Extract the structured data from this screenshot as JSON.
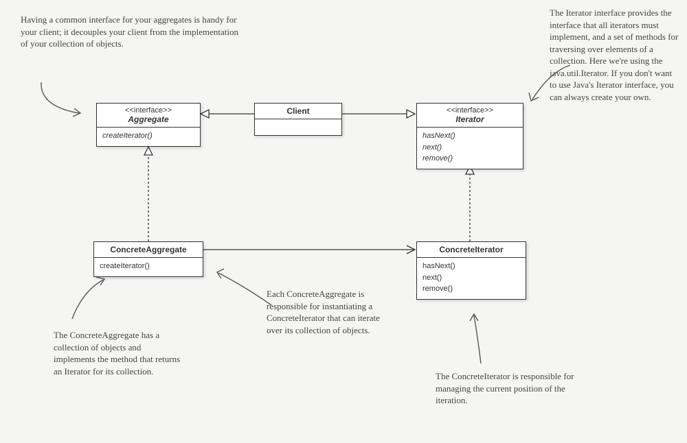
{
  "boxes": {
    "aggregate": {
      "stereo": "<<interface>>",
      "name": "Aggregate",
      "methods": [
        "createIterator()"
      ]
    },
    "client": {
      "name": "Client"
    },
    "iterator": {
      "stereo": "<<interface>>",
      "name": "Iterator",
      "methods": [
        "hasNext()",
        "next()",
        "remove()"
      ]
    },
    "concreteAggregate": {
      "name": "ConcreteAggregate",
      "methods": [
        "createIterator()"
      ]
    },
    "concreteIterator": {
      "name": "ConcreteIterator",
      "methods": [
        "hasNext()",
        "next()",
        "remove()"
      ]
    }
  },
  "notes": {
    "topLeft": "Having a common interface for your aggregates is handy for your client; it decouples your client from the implementation of your collection of objects.",
    "topRight": "The Iterator interface provides the interface that all iterators must implement, and a set of methods for traversing over elements of a collection. Here we're using the java.util.Iterator. If you don't want to use Java's Iterator interface, you can always create your own.",
    "bottomLeft": "The ConcreteAggregate has a collection of objects and implements the method that returns an Iterator for its collection.",
    "bottomMid": "Each ConcreteAggregate is responsible for instantiating a ConcreteIterator that can iterate over its collection of objects.",
    "bottomRight": "The ConcreteIterator is responsible for managing the current position of the iteration."
  }
}
